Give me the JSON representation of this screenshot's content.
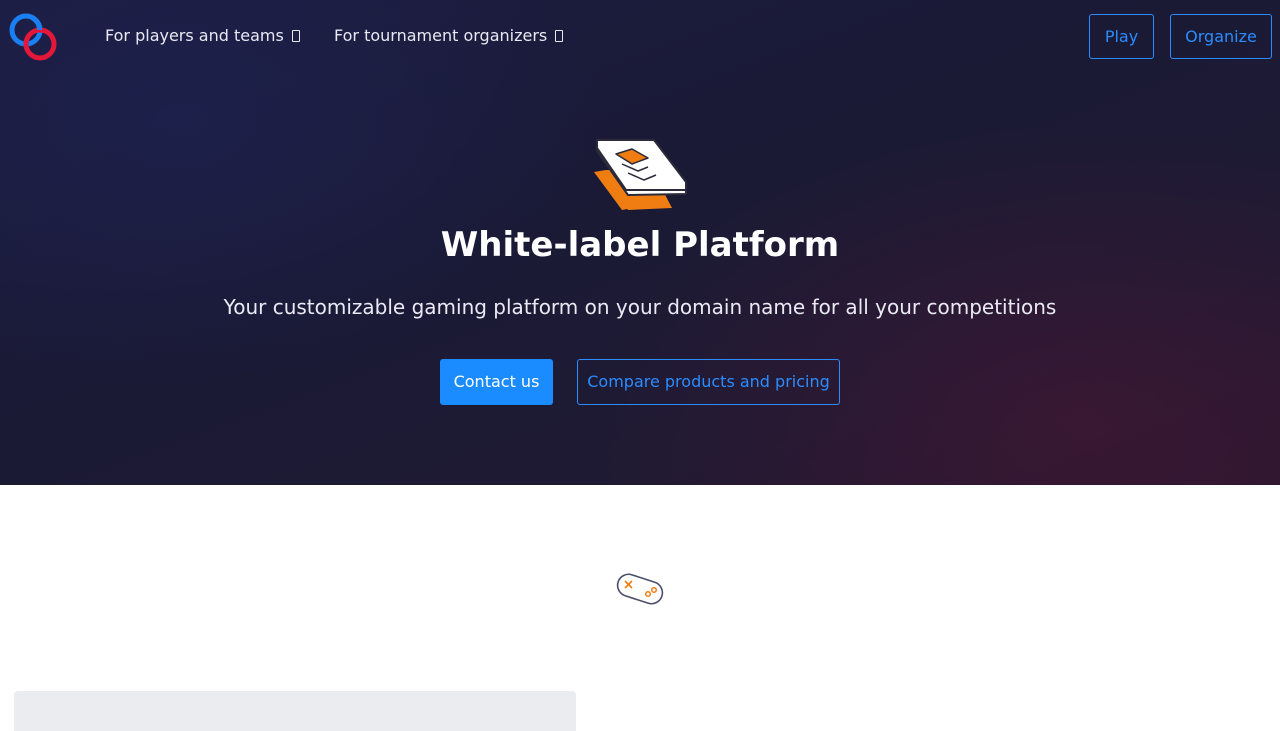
{
  "nav": {
    "logo_icon": "linked-rings-logo-icon",
    "menu": [
      {
        "label": "For players and teams",
        "icon": "chevron-down-icon"
      },
      {
        "label": "For tournament organizers",
        "icon": "chevron-down-icon"
      }
    ],
    "play_label": "Play",
    "organize_label": "Organize"
  },
  "hero": {
    "icon": "layered-platform-icon",
    "title": "White-label Platform",
    "subtitle": "Your customizable gaming platform on your domain name for all your competitions",
    "primary_cta": "Contact us",
    "secondary_cta": "Compare products and pricing"
  },
  "section": {
    "icon": "gamepad-icon"
  },
  "colors": {
    "accent_blue": "#1a8cff",
    "logo_blue": "#1a7ff2",
    "logo_red": "#e2173a",
    "icon_orange": "#f07d12",
    "hero_bg": "#1b1b3a",
    "card_bg": "#ebecf0"
  }
}
